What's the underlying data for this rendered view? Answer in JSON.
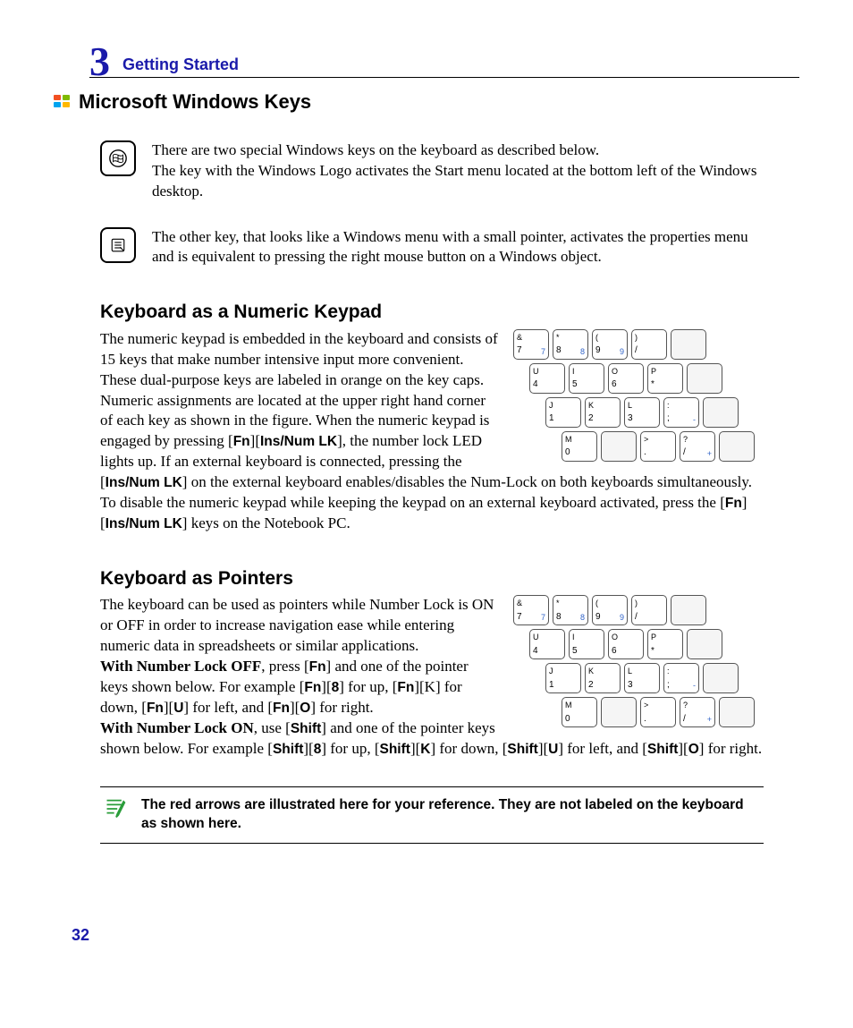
{
  "chapter": {
    "number": "3",
    "title": "Getting Started"
  },
  "section1": {
    "title": "Microsoft Windows Keys",
    "para1": "There are two special Windows keys on the keyboard as described below.",
    "para2": "The key with the Windows Logo activates the Start menu located at the bottom left of the Windows desktop.",
    "para3": "The other key, that looks like a Windows menu with a small pointer, activates the properties menu and is equivalent to pressing the right mouse button on a Windows object."
  },
  "section2": {
    "title": "Keyboard as a Numeric Keypad",
    "body_pre": "The numeric keypad is embedded in the keyboard and consists of 15 keys that make number intensive input more convenient. These dual-purpose keys are labeled in orange on the key caps. Numeric assignments are located at the upper right hand corner of each key as shown in the figure. When the numeric keypad is engaged by pressing [",
    "fn1": "Fn",
    "mid1": "][",
    "insnum1": "Ins/Num LK",
    "mid2": "], the number lock LED lights up. If an external keyboard is connected, pressing the [",
    "insnum2": "Ins/Num LK",
    "mid3": "] on the external keyboard enables/disables the Num-Lock on both keyboards simultaneously. To disable the numeric keypad while keeping the keypad on an external keyboard activated, press the  [",
    "fn2": "Fn",
    "mid4": "][",
    "insnum3": "Ins/Num LK",
    "mid5": "] keys on the Notebook PC."
  },
  "section3": {
    "title": "Keyboard as Pointers",
    "p1": "The keyboard can be used as pointers while Number Lock is ON or OFF in order to increase navigation ease while entering numeric data in spreadsheets or similar applications.",
    "p2a": "With Number Lock OFF",
    "p2b": ", press [",
    "fn": "Fn",
    "p2c": "] and one of the pointer keys shown below. For example [",
    "p2d": "][",
    "eight": "8",
    "p2e": "] for up, [",
    "p2f": "][K] for down, [",
    "u": "U",
    "p2g": "] for left, and [",
    "o": "O",
    "p2h": "] for right.",
    "p3a": "With Number Lock ON",
    "p3b": ", use [",
    "shift": "Shift",
    "p3c": "] and one of the pointer keys shown below. For example [",
    "p3d": "] for up, [",
    "k": "K",
    "p3e": "] for down, [",
    "p3f": "] for left, and [",
    "p3g": "] for right."
  },
  "note": "The red arrows are illustrated here for your reference. They are not labeled on the keyboard as shown here.",
  "page_number": "32",
  "keypad": {
    "row1": [
      {
        "tl": "&",
        "bl": "7",
        "br": "7"
      },
      {
        "tl": "*",
        "bl": "8",
        "br": "8"
      },
      {
        "tl": "(",
        "bl": "9",
        "br": "9"
      },
      {
        "tl": ")",
        "bl": "/",
        "br": ""
      },
      {
        "blank": true
      }
    ],
    "row2": [
      {
        "tl": "U",
        "bl": "4",
        "br": ""
      },
      {
        "tl": "I",
        "bl": "5",
        "br": ""
      },
      {
        "tl": "O",
        "bl": "6",
        "br": ""
      },
      {
        "tl": "P",
        "bl": "*",
        "br": ""
      },
      {
        "blank": true
      }
    ],
    "row3": [
      {
        "tl": "J",
        "bl": "1",
        "br": ""
      },
      {
        "tl": "K",
        "bl": "2",
        "br": ""
      },
      {
        "tl": "L",
        "bl": "3",
        "br": ""
      },
      {
        "tl": ":",
        "bl": ";",
        "br": "-"
      },
      {
        "blank": true
      }
    ],
    "row4": [
      {
        "tl": "M",
        "bl": "0",
        "br": ""
      },
      {
        "blank": true
      },
      {
        "tl": ">",
        "bl": ".",
        "br": ""
      },
      {
        "tl": "?",
        "bl": "/",
        "br": "+"
      },
      {
        "blank": true
      }
    ]
  }
}
